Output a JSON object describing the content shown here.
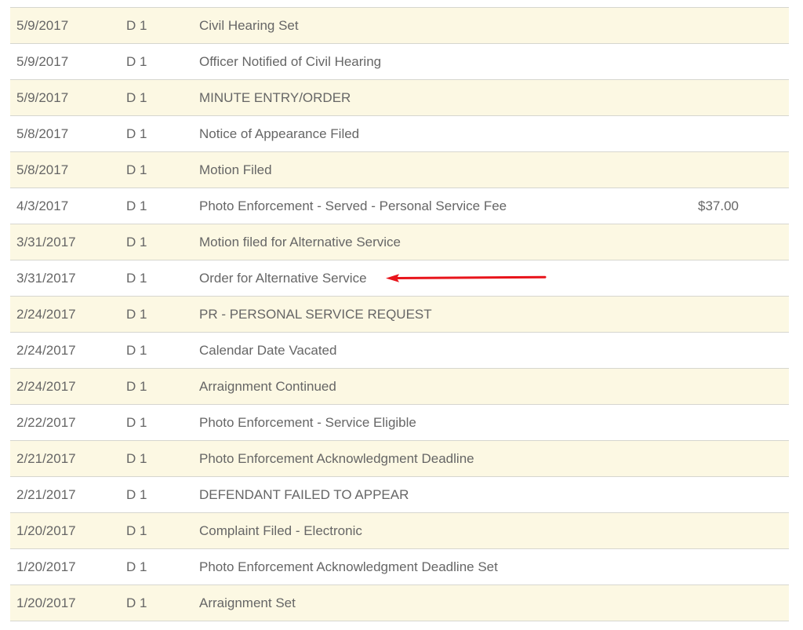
{
  "docket": {
    "rows": [
      {
        "date": "5/9/2017",
        "party": "D 1",
        "description": "Civil Hearing Set",
        "amount": ""
      },
      {
        "date": "5/9/2017",
        "party": "D 1",
        "description": "Officer Notified of Civil Hearing",
        "amount": ""
      },
      {
        "date": "5/9/2017",
        "party": "D 1",
        "description": "MINUTE ENTRY/ORDER",
        "amount": ""
      },
      {
        "date": "5/8/2017",
        "party": "D 1",
        "description": "Notice of Appearance Filed",
        "amount": ""
      },
      {
        "date": "5/8/2017",
        "party": "D 1",
        "description": "Motion Filed",
        "amount": ""
      },
      {
        "date": "4/3/2017",
        "party": "D 1",
        "description": "Photo Enforcement - Served - Personal Service Fee",
        "amount": "$37.00"
      },
      {
        "date": "3/31/2017",
        "party": "D 1",
        "description": "Motion filed for Alternative Service",
        "amount": ""
      },
      {
        "date": "3/31/2017",
        "party": "D 1",
        "description": "Order for Alternative Service",
        "amount": ""
      },
      {
        "date": "2/24/2017",
        "party": "D 1",
        "description": "PR - PERSONAL SERVICE REQUEST",
        "amount": ""
      },
      {
        "date": "2/24/2017",
        "party": "D 1",
        "description": "Calendar Date Vacated",
        "amount": ""
      },
      {
        "date": "2/24/2017",
        "party": "D 1",
        "description": "Arraignment Continued",
        "amount": ""
      },
      {
        "date": "2/22/2017",
        "party": "D 1",
        "description": "Photo Enforcement - Service Eligible",
        "amount": ""
      },
      {
        "date": "2/21/2017",
        "party": "D 1",
        "description": "Photo Enforcement Acknowledgment Deadline",
        "amount": ""
      },
      {
        "date": "2/21/2017",
        "party": "D 1",
        "description": "DEFENDANT FAILED TO APPEAR",
        "amount": ""
      },
      {
        "date": "1/20/2017",
        "party": "D 1",
        "description": "Complaint Filed - Electronic",
        "amount": ""
      },
      {
        "date": "1/20/2017",
        "party": "D 1",
        "description": "Photo Enforcement Acknowledgment Deadline Set",
        "amount": ""
      },
      {
        "date": "1/20/2017",
        "party": "D 1",
        "description": "Arraignment Set",
        "amount": ""
      }
    ]
  },
  "annotation": {
    "icon": "arrow-left-icon",
    "color": "#e8141b"
  }
}
